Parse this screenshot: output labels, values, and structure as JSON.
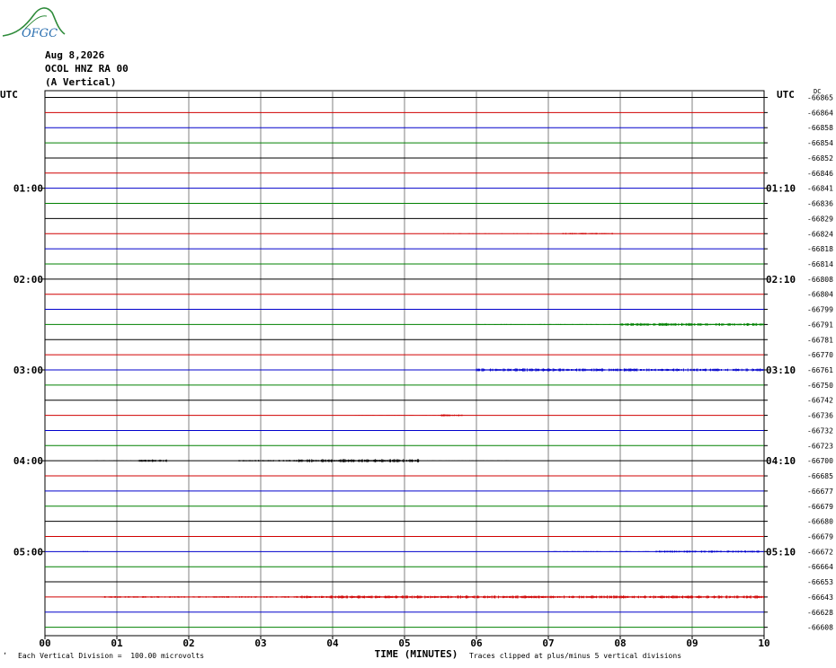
{
  "header": {
    "logo_text": "OFGC",
    "date": "Aug 8,2026",
    "station": "OCOL HNZ RA 00",
    "component": "(A Vertical)"
  },
  "axes": {
    "left_utc_label": "UTC",
    "right_utc_label": "UTC",
    "dc_label": "DC"
  },
  "footer": {
    "scale_note": "Each Vertical Division =  100.00 microvolts",
    "xlabel": "TIME (MINUTES)",
    "clip_note": "Traces clipped at plus/minus 5 vertical divisions"
  },
  "colors": {
    "black": "#000000",
    "red": "#d00000",
    "blue": "#0000cc",
    "green": "#008000",
    "grid": "#808080",
    "logo": "#2a6fb0",
    "logo_wave": "#2e8b3a"
  },
  "chart_data": {
    "type": "line",
    "title": "",
    "xlabel": "TIME (MINUTES)",
    "ylabel": "",
    "x_ticks": [
      "00",
      "01",
      "02",
      "03",
      "04",
      "05",
      "06",
      "07",
      "08",
      "09",
      "10"
    ],
    "xlim": [
      0,
      10
    ],
    "trace_color_cycle": [
      "black",
      "red",
      "blue",
      "green"
    ],
    "trace_count": 36,
    "left_time_labels": [
      {
        "trace": 6,
        "label": "01:00"
      },
      {
        "trace": 12,
        "label": "02:00"
      },
      {
        "trace": 18,
        "label": "03:00"
      },
      {
        "trace": 24,
        "label": "04:00"
      },
      {
        "trace": 30,
        "label": "05:00"
      }
    ],
    "right_time_labels": [
      {
        "trace": 6,
        "label": "01:10"
      },
      {
        "trace": 12,
        "label": "02:10"
      },
      {
        "trace": 18,
        "label": "03:10"
      },
      {
        "trace": 24,
        "label": "04:10"
      },
      {
        "trace": 30,
        "label": "05:10"
      }
    ],
    "dc_offsets": [
      "-66865",
      "-66864",
      "-66858",
      "-66854",
      "-66852",
      "-66846",
      "-66841",
      "-66836",
      "-66829",
      "-66824",
      "-66818",
      "-66814",
      "-66808",
      "-66804",
      "-66799",
      "-66791",
      "-66781",
      "-66770",
      "-66761",
      "-66750",
      "-66742",
      "-66736",
      "-66732",
      "-66723",
      "-66700",
      "-66685",
      "-66677",
      "-66679",
      "-66680",
      "-66679",
      "-66672",
      "-66664",
      "-66653",
      "-66643",
      "-66628",
      "-66608"
    ],
    "activity": [
      {
        "trace": 9,
        "from": 5.5,
        "to": 7.0,
        "level": 0.2
      },
      {
        "trace": 9,
        "from": 7.2,
        "to": 7.9,
        "level": 0.5
      },
      {
        "trace": 15,
        "from": 6.0,
        "to": 8.0,
        "level": 0.3
      },
      {
        "trace": 15,
        "from": 8.0,
        "to": 10.0,
        "level": 0.9
      },
      {
        "trace": 18,
        "from": 4.0,
        "to": 6.0,
        "level": 0.3
      },
      {
        "trace": 18,
        "from": 6.0,
        "to": 10.0,
        "level": 0.9
      },
      {
        "trace": 21,
        "from": 4.3,
        "to": 5.5,
        "level": 0.2
      },
      {
        "trace": 21,
        "from": 5.5,
        "to": 5.8,
        "level": 0.6
      },
      {
        "trace": 24,
        "from": 0.7,
        "to": 1.2,
        "level": 0.2
      },
      {
        "trace": 24,
        "from": 1.3,
        "to": 1.7,
        "level": 0.8
      },
      {
        "trace": 24,
        "from": 2.7,
        "to": 3.5,
        "level": 0.5
      },
      {
        "trace": 24,
        "from": 3.5,
        "to": 5.2,
        "level": 1.0
      },
      {
        "trace": 24,
        "from": 5.2,
        "to": 6.5,
        "level": 0.2
      },
      {
        "trace": 24,
        "from": 6.5,
        "to": 8.5,
        "level": 0.1
      },
      {
        "trace": 30,
        "from": 0.5,
        "to": 0.6,
        "level": 0.4
      },
      {
        "trace": 30,
        "from": 7.0,
        "to": 8.5,
        "level": 0.3
      },
      {
        "trace": 30,
        "from": 8.5,
        "to": 10.0,
        "level": 0.7
      },
      {
        "trace": 33,
        "from": 0.8,
        "to": 3.5,
        "level": 0.5
      },
      {
        "trace": 33,
        "from": 3.5,
        "to": 10.0,
        "level": 0.9
      }
    ]
  }
}
